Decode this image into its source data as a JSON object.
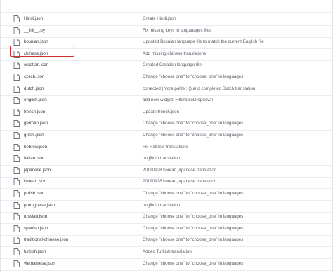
{
  "parent_dir_label": "..",
  "files": [
    {
      "name": "Hindi.json",
      "commit": "Create Hindi.json"
    },
    {
      "name": "__init__.py",
      "commit": "Fix missing keys in langauages files"
    },
    {
      "name": "bosnian.json",
      "commit": "Updated Bosnian language file to match the current English file"
    },
    {
      "name": "chinese.json",
      "commit": "Add missing chinese translations",
      "highlighted": true
    },
    {
      "name": "croatian.json",
      "commit": "Created Croatian language file"
    },
    {
      "name": "czech.json",
      "commit": "Change \"choose one\" to \"choose_one\" in languages"
    },
    {
      "name": "dutch.json",
      "commit": "corrected (more polite :-)) and completed Dutch translation"
    },
    {
      "name": "english.json",
      "commit": "add new widget: FilterableDropdown"
    },
    {
      "name": "french.json",
      "commit": "Update french.json"
    },
    {
      "name": "german.json",
      "commit": "Change \"choose one\" to \"choose_one\" in languages"
    },
    {
      "name": "greek.json",
      "commit": "Change \"choose one\" to \"choose_one\" in languages"
    },
    {
      "name": "hebrew.json",
      "commit": "Fix Hebrew translations"
    },
    {
      "name": "italian.json",
      "commit": "bugfix in translation"
    },
    {
      "name": "japanese.json",
      "commit": "20190928 korean,japanese translation"
    },
    {
      "name": "korean.json",
      "commit": "20190928 korean,japanese translation"
    },
    {
      "name": "polish.json",
      "commit": "Change \"choose one\" to \"choose_one\" in languages"
    },
    {
      "name": "portuguese.json",
      "commit": "bugfix in translation"
    },
    {
      "name": "russian.json",
      "commit": "Change \"choose one\" to \"choose_one\" in languages"
    },
    {
      "name": "spanish.json",
      "commit": "Change \"choose one\" to \"choose_one\" in languages"
    },
    {
      "name": "traditional-chinese.json",
      "commit": "Change \"choose one\" to \"choose_one\" in languages"
    },
    {
      "name": "turkish.json",
      "commit": "Added Turkish translation"
    },
    {
      "name": "vietnamese.json",
      "commit": "Change \"choose one\" to \"choose_one\" in languages"
    }
  ],
  "icon": "file-icon",
  "colors": {
    "highlight_border": "#d32f2f",
    "row_border": "#eaecef",
    "icon_stroke": "#6a737d"
  }
}
